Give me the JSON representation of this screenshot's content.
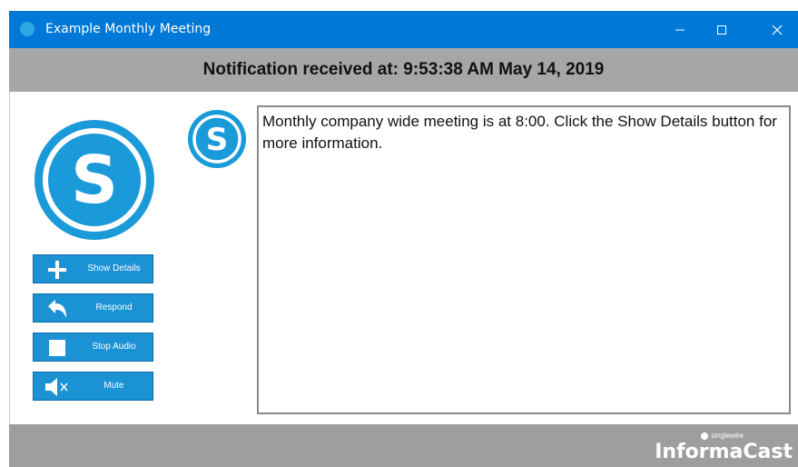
{
  "window": {
    "title": "Example Monthly Meeting",
    "minimize_icon": "minimize-icon",
    "maximize_icon": "maximize-icon",
    "close_icon": "close-icon"
  },
  "notification": {
    "header": "Notification received at: 9:53:38 AM May 14, 2019",
    "message": "Monthly company wide meeting is at 8:00. Click the Show Details button for more information."
  },
  "actions": [
    {
      "label": "Show Details",
      "icon": "plus-icon"
    },
    {
      "label": "Respond",
      "icon": "reply-icon"
    },
    {
      "label": "Stop Audio",
      "icon": "stop-icon"
    },
    {
      "label": "Mute",
      "icon": "speaker-mute-icon"
    }
  ],
  "footer": {
    "brand_small": "singlewire",
    "brand": "InformaCast"
  },
  "colors": {
    "titlebar": "#0078d7",
    "accent": "#1a92d4",
    "bar_gray": "#a6a6a6"
  }
}
